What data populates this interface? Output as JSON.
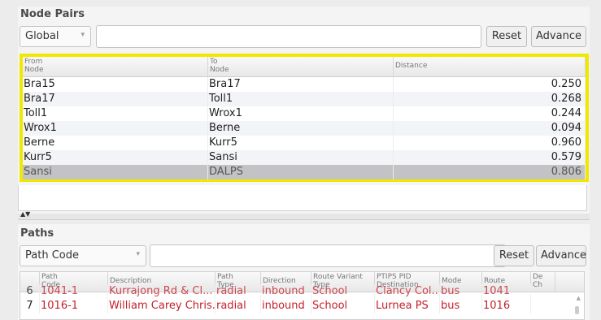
{
  "node_pairs": {
    "title": "Node Pairs",
    "scope_select": "Global",
    "filter_value": "",
    "reset_label": "Reset",
    "advance_label": "Advance",
    "columns": {
      "from": [
        "From",
        "Node"
      ],
      "to": [
        "To",
        "Node"
      ],
      "distance": "Distance"
    },
    "rows": [
      {
        "from": "Bra15",
        "to": "Bra17",
        "distance": "0.250"
      },
      {
        "from": "Bra17",
        "to": "Toll1",
        "distance": "0.268"
      },
      {
        "from": "Toll1",
        "to": "Wrox1",
        "distance": "0.244"
      },
      {
        "from": "Wrox1",
        "to": "Berne",
        "distance": "0.094"
      },
      {
        "from": "Berne",
        "to": "Kurr5",
        "distance": "0.960"
      },
      {
        "from": "Kurr5",
        "to": "Sansi",
        "distance": "0.579"
      },
      {
        "from": "Sansi",
        "to": "DALPS",
        "distance": "0.806"
      }
    ],
    "selected_row": 6,
    "highlight_color": "#f0e800"
  },
  "paths": {
    "title": "Paths",
    "field_select": "Path Code",
    "filter_value": "",
    "reset_label": "Reset",
    "advance_label": "Advance",
    "columns": {
      "code": [
        "Path",
        "Code"
      ],
      "description": "Description",
      "type": [
        "Path",
        "Type"
      ],
      "direction": "Direction",
      "variant": [
        "Route Variant",
        "Type"
      ],
      "destination": [
        "PTIPS PID",
        "Destination"
      ],
      "mode": "Mode",
      "route": "Route",
      "de": [
        "De",
        "Ch"
      ]
    },
    "partial_row": {
      "idx": "6",
      "code": "1041-1",
      "description": "Kurrajong Rd & Cl...",
      "type": "radial",
      "direction": "inbound",
      "variant": "School",
      "destination": "Clancy Col...",
      "mode": "bus",
      "route": "1041"
    },
    "rows": [
      {
        "idx": "7",
        "code": "1016-1",
        "description": "William Carey Chris...",
        "type": "radial",
        "direction": "inbound",
        "variant": "School",
        "destination": "Lurnea PS",
        "mode": "bus",
        "route": "1016"
      }
    ],
    "row_text_color": "#c4202a"
  },
  "icons": {
    "dropdown": "chevron-down-icon",
    "splitter": "collapse-arrows-icon"
  }
}
